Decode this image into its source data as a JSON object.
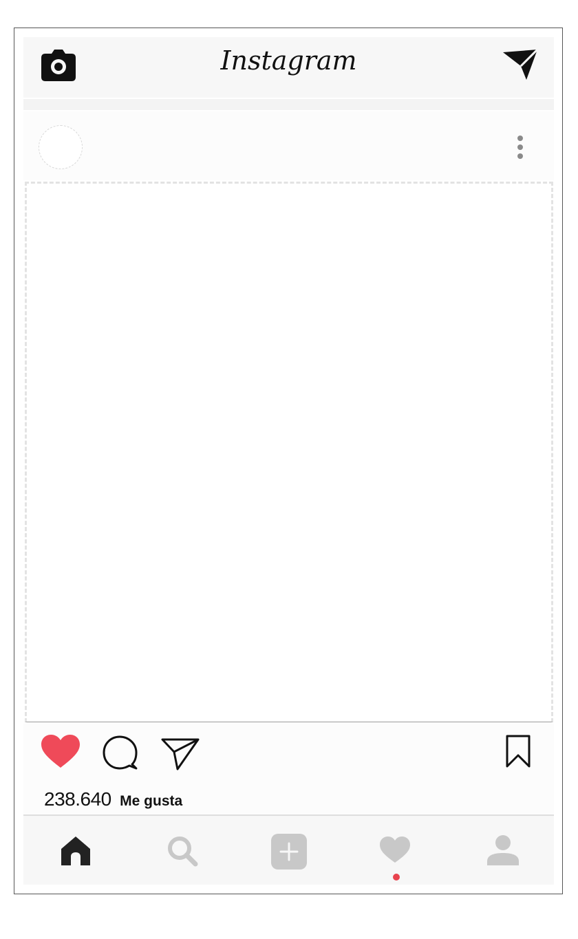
{
  "header": {
    "logo_text": "Instagram"
  },
  "post": {
    "likes_count": "238.640",
    "likes_label": "Me gusta",
    "liked": true
  },
  "icons": {
    "camera": "camera-icon",
    "direct": "paper-plane-icon",
    "more": "more-vertical-icon",
    "like": "heart-icon",
    "comment": "comment-icon",
    "share": "send-icon",
    "bookmark": "bookmark-icon",
    "home": "home-icon",
    "search": "search-icon",
    "add": "add-icon",
    "activity": "heart-icon",
    "profile": "profile-icon"
  },
  "colors": {
    "like": "#ef4a59",
    "notification_dot": "#e8434e",
    "inactive_nav": "#c8c8c8",
    "active_nav": "#222222"
  }
}
